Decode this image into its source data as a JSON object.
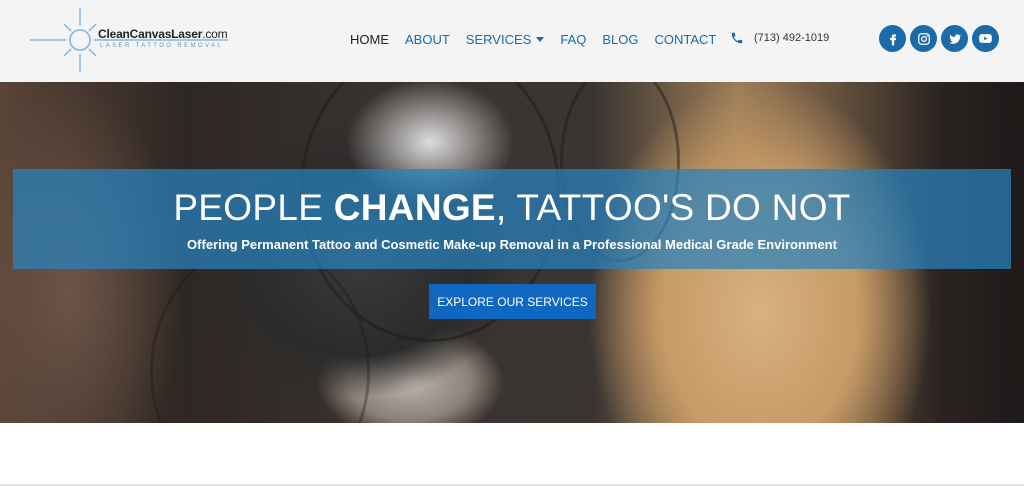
{
  "logo": {
    "name_bold": "CleanCanvasLaser",
    "name_domain": ".com",
    "tagline": "LASER TATTOO REMOVAL"
  },
  "nav": {
    "items": [
      {
        "label": "HOME",
        "active": true
      },
      {
        "label": "ABOUT",
        "active": false
      },
      {
        "label": "SERVICES",
        "active": false,
        "has_dropdown": true
      },
      {
        "label": "FAQ",
        "active": false
      },
      {
        "label": "BLOG",
        "active": false
      },
      {
        "label": "CONTACT",
        "active": false
      }
    ]
  },
  "contact": {
    "phone": "(713) 492-1019",
    "icon": "phone-icon"
  },
  "social": [
    {
      "icon": "facebook-icon"
    },
    {
      "icon": "instagram-icon"
    },
    {
      "icon": "twitter-icon"
    },
    {
      "icon": "youtube-icon"
    }
  ],
  "hero": {
    "headline_pre": "PEOPLE ",
    "headline_bold": "CHANGE",
    "headline_post": ", TATTOO'S DO NOT",
    "subheadline": "Offering Permanent Tattoo and Cosmetic Make-up Removal in a Professional Medical Grade Environment",
    "cta_label": "EXPLORE OUR SERVICES"
  },
  "colors": {
    "accent": "#1c6aa8",
    "band": "#2882be",
    "button": "#1067c2",
    "header_bg": "#f4f4f4"
  }
}
